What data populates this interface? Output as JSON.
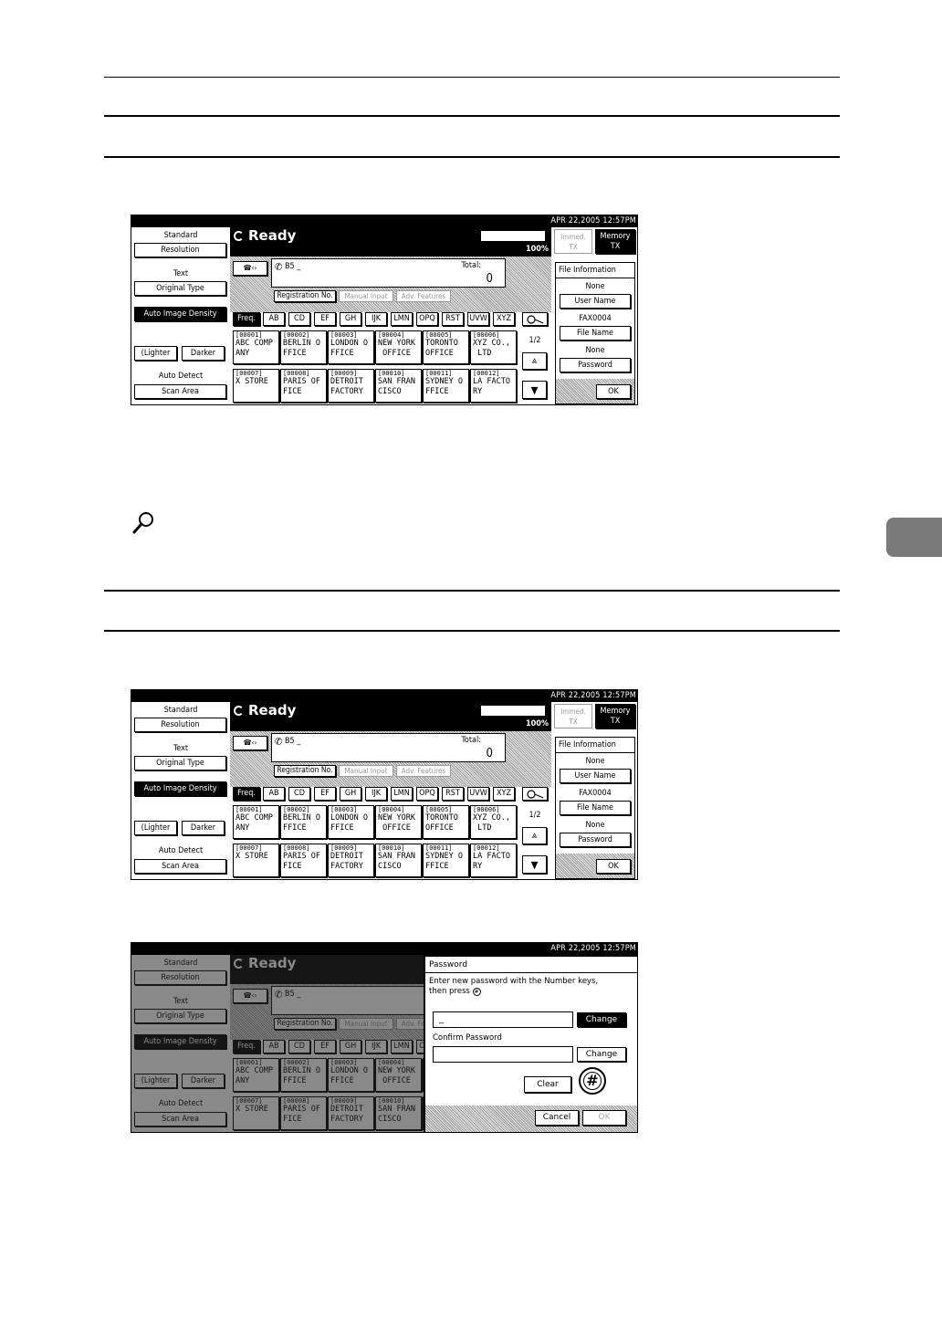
{
  "panel": {
    "datetime": "APR   22,2005 12:57PM",
    "status": "Ready",
    "percent": "100%",
    "left": {
      "standard": "Standard",
      "resolution": "Resolution",
      "text": "Text",
      "original_type": "Original Type",
      "auto_image_density": "Auto Image Density",
      "lighter": "(Lighter",
      "darker": "Darker",
      "auto_detect": "Auto Detect",
      "scan_area": "Scan Area"
    },
    "information": "Information",
    "memory_tx": "Memory\nTX",
    "immed_tx": "Immed.\nTX",
    "dest_number": "B5 _",
    "total_label": "Total:",
    "total_value": "0",
    "registration_no": "Registration No.",
    "manual_input": "Manual Input",
    "adv_features": "Adv. Features",
    "tabs": [
      "Freq.",
      "AB",
      "CD",
      "EF",
      "GH",
      "IJK",
      "LMN",
      "OPQ",
      "RST",
      "UVW",
      "XYZ"
    ],
    "page": "1/2",
    "row1": [
      {
        "code": "[00001]",
        "name": "ABC COMP\nANY"
      },
      {
        "code": "[00002]",
        "name": "BERLIN O\nFFICE"
      },
      {
        "code": "[00003]",
        "name": "LONDON O\nFFICE"
      },
      {
        "code": "[00004]",
        "name": "NEW YORK\n OFFICE"
      },
      {
        "code": "[00005]",
        "name": "TORONTO\nOFFICE"
      },
      {
        "code": "[00006]",
        "name": "XYZ CO.,\n LTD"
      }
    ],
    "row2": [
      {
        "code": "[00007]",
        "name": "X STORE"
      },
      {
        "code": "[00008]",
        "name": "PARIS OF\nFICE"
      },
      {
        "code": "[00009]",
        "name": "DETROIT\nFACTORY"
      },
      {
        "code": "[00010]",
        "name": "SAN FRAN\nCISCO"
      },
      {
        "code": "[00011]",
        "name": "SYDNEY O\nFFICE"
      },
      {
        "code": "[00012]",
        "name": "LA FACTO\nRY"
      }
    ],
    "file_info": {
      "title": "File Information",
      "none1": "None",
      "user_name": "User Name",
      "fax_name": "FAX0004",
      "file_name": "File Name",
      "none2": "None",
      "password": "Password",
      "ok": "OK"
    }
  },
  "dialog": {
    "title": "Password",
    "instruction_1": "Enter new password with the Number keys,",
    "instruction_2": "then press",
    "field_value": "_",
    "change": "Change",
    "confirm_label": "Confirm Password",
    "clear": "Clear",
    "hash": "#",
    "cancel": "Cancel",
    "ok": "OK"
  }
}
